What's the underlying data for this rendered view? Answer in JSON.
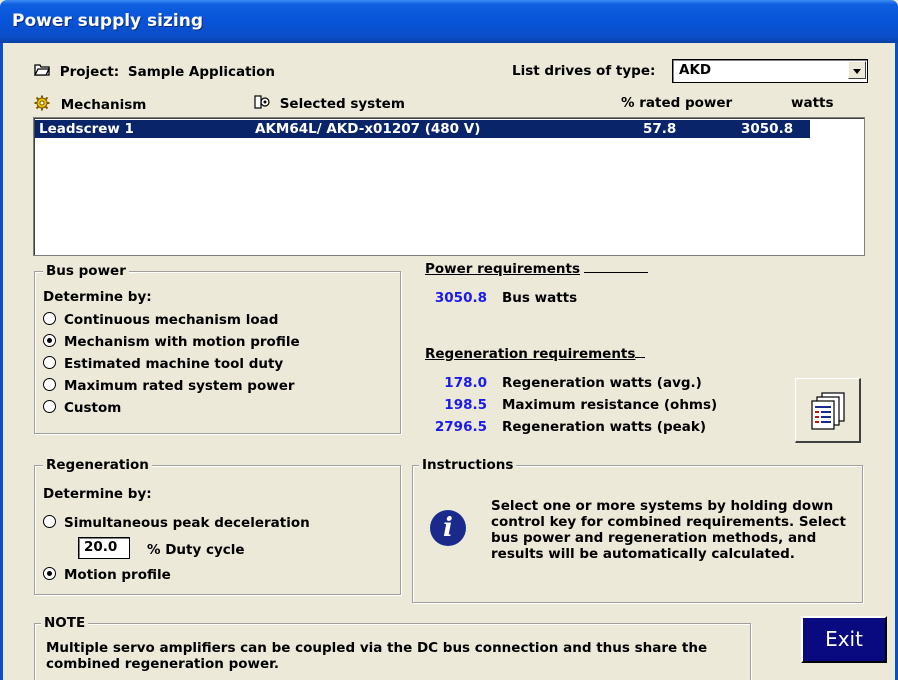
{
  "window": {
    "title": "Power supply sizing"
  },
  "project": {
    "icon": "folder-icon",
    "label": "Project:",
    "name": "Sample Application"
  },
  "drive_filter": {
    "label": "List drives of type:",
    "selected": "AKD"
  },
  "list": {
    "headers": {
      "mechanism": "Mechanism",
      "system": "Selected system",
      "rated": "% rated power",
      "watts": "watts"
    },
    "rows": [
      {
        "mechanism": "Leadscrew 1",
        "system": "AKM64L/ AKD-x01207 (480 V)",
        "rated": "57.8",
        "watts": "3050.8"
      }
    ]
  },
  "bus_power": {
    "legend": "Bus power",
    "determine_by": "Determine by:",
    "options": [
      {
        "label": "Continuous mechanism load",
        "selected": false
      },
      {
        "label": "Mechanism with motion profile",
        "selected": true
      },
      {
        "label": "Estimated machine tool duty",
        "selected": false
      },
      {
        "label": "Maximum rated system power",
        "selected": false
      },
      {
        "label": "Custom",
        "selected": false
      }
    ]
  },
  "power_requirements": {
    "heading": "Power requirements",
    "value": "3050.8",
    "label": "Bus watts"
  },
  "regeneration_requirements": {
    "heading": "Regeneration requirements",
    "rows": [
      {
        "value": "178.0",
        "label": "Regeneration watts (avg.)"
      },
      {
        "value": "198.5",
        "label": "Maximum resistance (ohms)"
      },
      {
        "value": "2796.5",
        "label": "Regeneration watts (peak)"
      }
    ]
  },
  "regeneration": {
    "legend": "Regeneration",
    "determine_by": "Determine by:",
    "option_peak": "Simultaneous peak deceleration",
    "duty_value": "20.0",
    "duty_label": "% Duty cycle",
    "option_profile": "Motion profile",
    "selected": "Motion profile"
  },
  "instructions": {
    "legend": "Instructions",
    "text": "Select one or more systems by holding down control key for combined requirements. Select bus power and regeneration methods, and results will be automatically calculated."
  },
  "note": {
    "legend": "NOTE",
    "text": "Multiple servo amplifiers can be coupled via the DC bus connection and thus share the combined regeneration power."
  },
  "buttons": {
    "exit": "Exit"
  },
  "colors": {
    "titlebar": "#0853d8",
    "selection": "#0a246a",
    "value_blue": "#1a1aef",
    "exit_bg": "#0a0a80"
  }
}
